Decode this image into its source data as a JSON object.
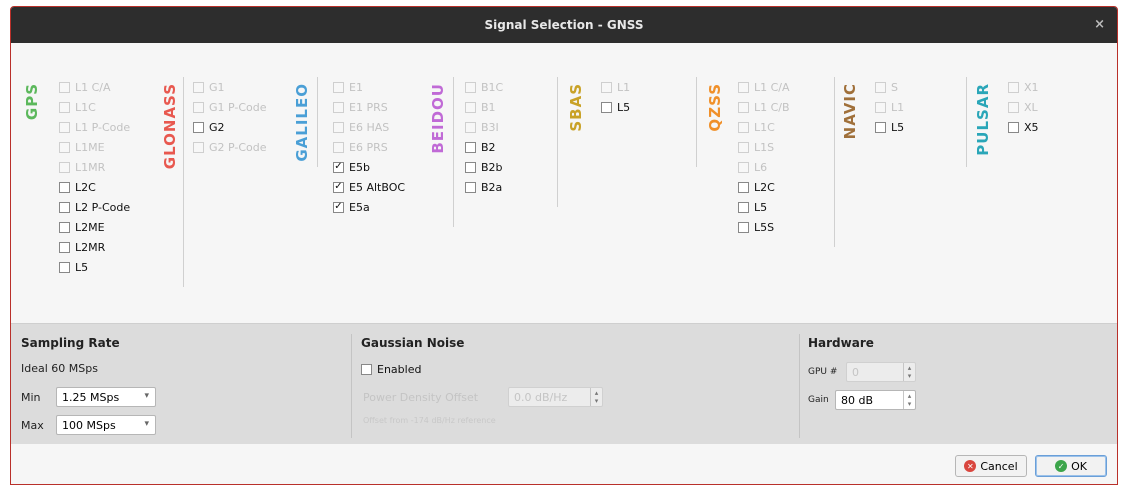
{
  "window": {
    "title": "Signal Selection - GNSS",
    "close_glyph": "×"
  },
  "systems": [
    {
      "name": "GPS",
      "color": "#5cb85c",
      "signals": [
        {
          "label": "L1 C/A",
          "enabled": false,
          "checked": false
        },
        {
          "label": "L1C",
          "enabled": false,
          "checked": false
        },
        {
          "label": "L1 P-Code",
          "enabled": false,
          "checked": false
        },
        {
          "label": "L1ME",
          "enabled": false,
          "checked": false
        },
        {
          "label": "L1MR",
          "enabled": false,
          "checked": false
        },
        {
          "label": "L2C",
          "enabled": true,
          "checked": false
        },
        {
          "label": "L2 P-Code",
          "enabled": true,
          "checked": false
        },
        {
          "label": "L2ME",
          "enabled": true,
          "checked": false
        },
        {
          "label": "L2MR",
          "enabled": true,
          "checked": false
        },
        {
          "label": "L5",
          "enabled": true,
          "checked": false
        }
      ]
    },
    {
      "name": "GLONASS",
      "color": "#e8584f",
      "signals": [
        {
          "label": "G1",
          "enabled": false,
          "checked": false
        },
        {
          "label": "G1 P-Code",
          "enabled": false,
          "checked": false
        },
        {
          "label": "G2",
          "enabled": true,
          "checked": false
        },
        {
          "label": "G2 P-Code",
          "enabled": false,
          "checked": false
        }
      ]
    },
    {
      "name": "GALILEO",
      "color": "#4a9fd6",
      "signals": [
        {
          "label": "E1",
          "enabled": false,
          "checked": false
        },
        {
          "label": "E1 PRS",
          "enabled": false,
          "checked": false
        },
        {
          "label": "E6 HAS",
          "enabled": false,
          "checked": false
        },
        {
          "label": "E6 PRS",
          "enabled": false,
          "checked": false
        },
        {
          "label": "E5b",
          "enabled": true,
          "checked": true
        },
        {
          "label": "E5 AltBOC",
          "enabled": true,
          "checked": true
        },
        {
          "label": "E5a",
          "enabled": true,
          "checked": true
        }
      ]
    },
    {
      "name": "BEIDOU",
      "color": "#c06ad6",
      "signals": [
        {
          "label": "B1C",
          "enabled": false,
          "checked": false
        },
        {
          "label": "B1",
          "enabled": false,
          "checked": false
        },
        {
          "label": "B3I",
          "enabled": false,
          "checked": false
        },
        {
          "label": "B2",
          "enabled": true,
          "checked": false
        },
        {
          "label": "B2b",
          "enabled": true,
          "checked": false
        },
        {
          "label": "B2a",
          "enabled": true,
          "checked": false
        }
      ]
    },
    {
      "name": "SBAS",
      "color": "#c9a227",
      "signals": [
        {
          "label": "L1",
          "enabled": false,
          "checked": false
        },
        {
          "label": "L5",
          "enabled": true,
          "checked": false
        }
      ]
    },
    {
      "name": "QZSS",
      "color": "#f0902a",
      "signals": [
        {
          "label": "L1 C/A",
          "enabled": false,
          "checked": false
        },
        {
          "label": "L1 C/B",
          "enabled": false,
          "checked": false
        },
        {
          "label": "L1C",
          "enabled": false,
          "checked": false
        },
        {
          "label": "L1S",
          "enabled": false,
          "checked": false
        },
        {
          "label": "L6",
          "enabled": false,
          "checked": false
        },
        {
          "label": "L2C",
          "enabled": true,
          "checked": false
        },
        {
          "label": "L5",
          "enabled": true,
          "checked": false
        },
        {
          "label": "L5S",
          "enabled": true,
          "checked": false
        }
      ]
    },
    {
      "name": "NAVIC",
      "color": "#a0703a",
      "signals": [
        {
          "label": "S",
          "enabled": false,
          "checked": false
        },
        {
          "label": "L1",
          "enabled": false,
          "checked": false
        },
        {
          "label": "L5",
          "enabled": true,
          "checked": false
        }
      ]
    },
    {
      "name": "PULSAR",
      "color": "#2aa6b8",
      "signals": [
        {
          "label": "X1",
          "enabled": false,
          "checked": false
        },
        {
          "label": "XL",
          "enabled": false,
          "checked": false
        },
        {
          "label": "X5",
          "enabled": true,
          "checked": false
        }
      ]
    }
  ],
  "sampling": {
    "title": "Sampling Rate",
    "ideal_label": "Ideal",
    "ideal_value": "60 MSps",
    "min_label": "Min",
    "min_value": "1.25 MSps",
    "max_label": "Max",
    "max_value": "100 MSps"
  },
  "noise": {
    "title": "Gaussian Noise",
    "enabled_label": "Enabled",
    "enabled": false,
    "pdo_label": "Power Density Offset",
    "pdo_value": "0.0 dB/Hz",
    "hint": "Offset from -174 dB/Hz reference"
  },
  "hardware": {
    "title": "Hardware",
    "gpu_label": "GPU #",
    "gpu_value": "0",
    "gain_label": "Gain",
    "gain_value": "80 dB"
  },
  "footer": {
    "cancel_label": "Cancel",
    "cancel_icon_color": "#d9463e",
    "ok_label": "OK",
    "ok_icon_color": "#3ca54b"
  },
  "colors": {
    "title_bar": "#2d2d2d",
    "border": "#b9302a"
  }
}
